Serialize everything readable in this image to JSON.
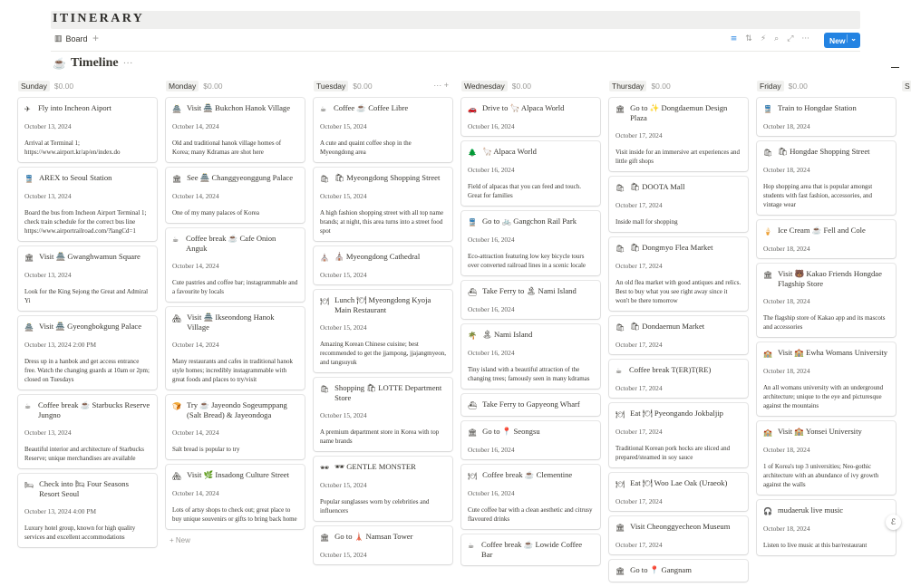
{
  "banner": "ITINERARY",
  "toolbar": {
    "view": "Board",
    "add": "+",
    "new": "New",
    "caret": "⌄"
  },
  "page": {
    "title": "Timeline",
    "dots": "···"
  },
  "columns": [
    {
      "day": "Sunday",
      "amount": "$0.00",
      "cards": [
        {
          "icon": "✈",
          "title": "Fly into Incheon Aiport",
          "date": "October 13, 2024",
          "note": "Arrival at Terminal 1;\nhttps://www.airport.kr/ap/en/index.do"
        },
        {
          "icon": "🚆",
          "title": "AREX to Seoul Station",
          "date": "October 13, 2024",
          "note": "Board the bus from Incheon Airport Terminal 1; check train schedule for the correct bus line\nhttps://www.airportrailroad.com/?langCd=1"
        },
        {
          "icon": "🏛",
          "title": "Visit 🏯 Gwanghwamun Square",
          "date": "October 13, 2024",
          "note": "Look for the King Sejong the Great and Admiral Yi"
        },
        {
          "icon": "🏯",
          "title": "Visit 🏯 Gyeongbokgung Palace",
          "date": "October 13, 2024 2:00 PM",
          "note": "Dress up in a hanbok and get access entrance free. Watch the changing guards at 10am or 2pm; closed on Tuesdays"
        },
        {
          "icon": "☕",
          "title": "Coffee break ☕ Starbucks Reserve Jungno",
          "date": "October 13, 2024",
          "note": "Beautiful interior and architecture of Starbucks Reserve; unique merchandises are available"
        },
        {
          "icon": "🛏",
          "title": "Check into 🛏 Four Seasons Resort Seoul",
          "date": "October 13, 2024 4:00 PM",
          "note": "Luxury hotel group, known for high quality services and excellent accommodations"
        }
      ]
    },
    {
      "day": "Monday",
      "amount": "$0.00",
      "cards": [
        {
          "icon": "🏯",
          "title": "Visit 🏯 Bukchon Hanok Village",
          "date": "October 14, 2024",
          "note": "Old and traditional hanok village homes of Korea; many Kdramas are shot here"
        },
        {
          "icon": "🏛",
          "title": "See 🏯 Changgyeonggung Palace",
          "date": "October 14, 2024",
          "note": "One of my many palaces of Korea"
        },
        {
          "icon": "☕",
          "title": "Coffee break ☕ Cafe Onion Anguk",
          "date": "October 14, 2024",
          "note": "Cute pastries and coffee bar; instagrammable and a favourite by locals"
        },
        {
          "icon": "🏘",
          "title": "Visit 🏯 Ikseondong Hanok Village",
          "date": "October 14, 2024",
          "note": "Many restaurants and cafes in traditional hanok style homes; incredibly instagrammable with great foods and places to try/visit"
        },
        {
          "icon": "🍞",
          "title": "Try ☕ Jayeondo Sogeumppang (Salt Bread) & Jayeondoga",
          "date": "October 14, 2024",
          "note": "Salt bread is popular to try"
        },
        {
          "icon": "🏘",
          "title": "Visit 🌿 Insadong Culture Street",
          "date": "October 14, 2024",
          "note": "Lots of artsy shops to check out; great place to buy unique souvenirs or gifts to bring back home"
        }
      ],
      "new": "+ New"
    },
    {
      "day": "Tuesday",
      "amount": "$0.00",
      "actions": "··· +",
      "cards": [
        {
          "icon": "☕",
          "title": "Coffee ☕ Coffee Libre",
          "date": "October 15, 2024",
          "note": "A cute and quaint coffee shop in the Myeongdong area"
        },
        {
          "icon": "🛍",
          "title": "🛍 Myeongdong Shopping Street",
          "date": "October 15, 2024",
          "note": "A high fashion shopping street with all top name brands; at night, this area turns into a street food spot"
        },
        {
          "icon": "⛪",
          "title": "⛪ Myeongdong Cathedral",
          "date": "October 15, 2024",
          "note": ""
        },
        {
          "icon": "🍽",
          "title": "Lunch 🍽 Myeongdong Kyoja Main Restaurant",
          "date": "October 15, 2024",
          "note": "Amazing Korean Chinese cuisine; best recommended to get the jjampong, jjajangmyeon, and tangsuyuk"
        },
        {
          "icon": "🛍",
          "title": "Shopping 🛍 LOTTE Department Store",
          "date": "October 15, 2024",
          "note": "A premium department store in Korea with top name brands"
        },
        {
          "icon": "🕶",
          "title": "🕶 GENTLE MONSTER",
          "date": "October 15, 2024",
          "note": "Popular sunglasses worn by celebrities and influencers"
        },
        {
          "icon": "🏛",
          "title": "Go to 🗼 Namsan Tower",
          "date": "October 15, 2024",
          "note": ""
        }
      ]
    },
    {
      "day": "Wednesday",
      "amount": "$0.00",
      "cards": [
        {
          "icon": "🚗",
          "title": "Drive to 🦙 Alpaca World",
          "date": "October 16, 2024",
          "note": ""
        },
        {
          "icon": "🌲",
          "title": "🦙 Alpaca World",
          "date": "October 16, 2024",
          "note": "Field of alpacas that you can feed and touch. Great for families"
        },
        {
          "icon": "🚆",
          "title": "Go to 🚲 Gangchon Rail Park",
          "date": "October 16, 2024",
          "note": "Eco-attraction featuring low key bicycle tours over converted railroad lines in a scenic locale"
        },
        {
          "icon": "⛴",
          "title": "Take Ferry to 🏝 Nami Island",
          "date": "October 16, 2024",
          "note": ""
        },
        {
          "icon": "🌴",
          "title": "🏝 Nami Island",
          "date": "October 16, 2024",
          "note": "Tiny island with a beautiful attraction of the changing trees; famously seen in many kdramas"
        },
        {
          "icon": "⛴",
          "title": "Take Ferry to Gapyeong Wharf",
          "date": "",
          "note": ""
        },
        {
          "icon": "🏛",
          "title": "Go to 📍 Seongsu",
          "date": "October 16, 2024",
          "note": ""
        },
        {
          "icon": "🍽",
          "title": "Coffee break ☕ Clementine",
          "date": "October 16, 2024",
          "note": "Cute coffee bar with a clean aesthetic and citrusy flavoured drinks"
        },
        {
          "icon": "☕",
          "title": "Coffee break ☕ Lowide Coffee Bar",
          "date": "",
          "note": ""
        }
      ]
    },
    {
      "day": "Thursday",
      "amount": "$0.00",
      "cards": [
        {
          "icon": "🏛",
          "title": "Go to ✨ Dongdaemun Design Plaza",
          "date": "October 17, 2024",
          "note": "Visit inside for an immersive art experiences and little gift shops"
        },
        {
          "icon": "🛍",
          "title": "🛍 DOOTA Mall",
          "date": "October 17, 2024",
          "note": "Inside mall for shopping"
        },
        {
          "icon": "🛍",
          "title": "🛍 Dongmyo Flea Market",
          "date": "October 17, 2024",
          "note": "An old flea market with good antiques and relics. Best to buy what you see right away since it won't be there tomorrow"
        },
        {
          "icon": "🛍",
          "title": "🛍 Dondaemun Market",
          "date": "October 17, 2024",
          "note": ""
        },
        {
          "icon": "☕",
          "title": "Coffee break T(ER)T(RE)",
          "date": "October 17, 2024",
          "note": ""
        },
        {
          "icon": "🍽",
          "title": "Eat 🍽 Pyeongando Jokbaljip",
          "date": "October 17, 2024",
          "note": "Traditional Korean pork hocks are sliced and prepared/steamed in soy sauce"
        },
        {
          "icon": "🍽",
          "title": "Eat 🍽 Woo Lae Oak (Uraeok)",
          "date": "October 17, 2024",
          "note": ""
        },
        {
          "icon": "🏛",
          "title": "Visit Cheonggyecheon Museum",
          "date": "October 17, 2024",
          "note": ""
        },
        {
          "icon": "🏛",
          "title": "Go to 📍 Gangnam",
          "date": "",
          "note": ""
        }
      ]
    },
    {
      "day": "Friday",
      "amount": "$0.00",
      "cards": [
        {
          "icon": "🚆",
          "title": "Train to Hongdae Station",
          "date": "October 18, 2024",
          "note": ""
        },
        {
          "icon": "🛍",
          "title": "🛍 Hongdae Shopping Street",
          "date": "October 18, 2024",
          "note": "Hop shopping area that is popular amongst students with fast fashion, accessories, and vintage wear"
        },
        {
          "icon": "🍦",
          "title": "Ice Cream ☕ Fell and Cole",
          "date": "October 18, 2024",
          "note": ""
        },
        {
          "icon": "🏛",
          "title": "Visit 🐻 Kakao Friends Hongdae Flagship Store",
          "date": "October 18, 2024",
          "note": "The flagship store of Kakao app and its mascots and accessories"
        },
        {
          "icon": "🏫",
          "title": "Visit 🏫 Ewha Womans University",
          "date": "October 18, 2024",
          "note": "An all womans university with an underground architecture; unique to the eye and picturesque against the mountains"
        },
        {
          "icon": "🏫",
          "title": "Visit 🏫 Yonsei University",
          "date": "October 18, 2024",
          "note": "1 of Korea's top 3 universities; Neo-gothic architecture with an abundance of ivy growth against the walls"
        },
        {
          "icon": "🎧",
          "title": "mudaeruk live music",
          "date": "October 18, 2024",
          "note": "Listen to live music at this bar/restaurant"
        }
      ]
    }
  ],
  "edge": {
    "day": "S"
  }
}
